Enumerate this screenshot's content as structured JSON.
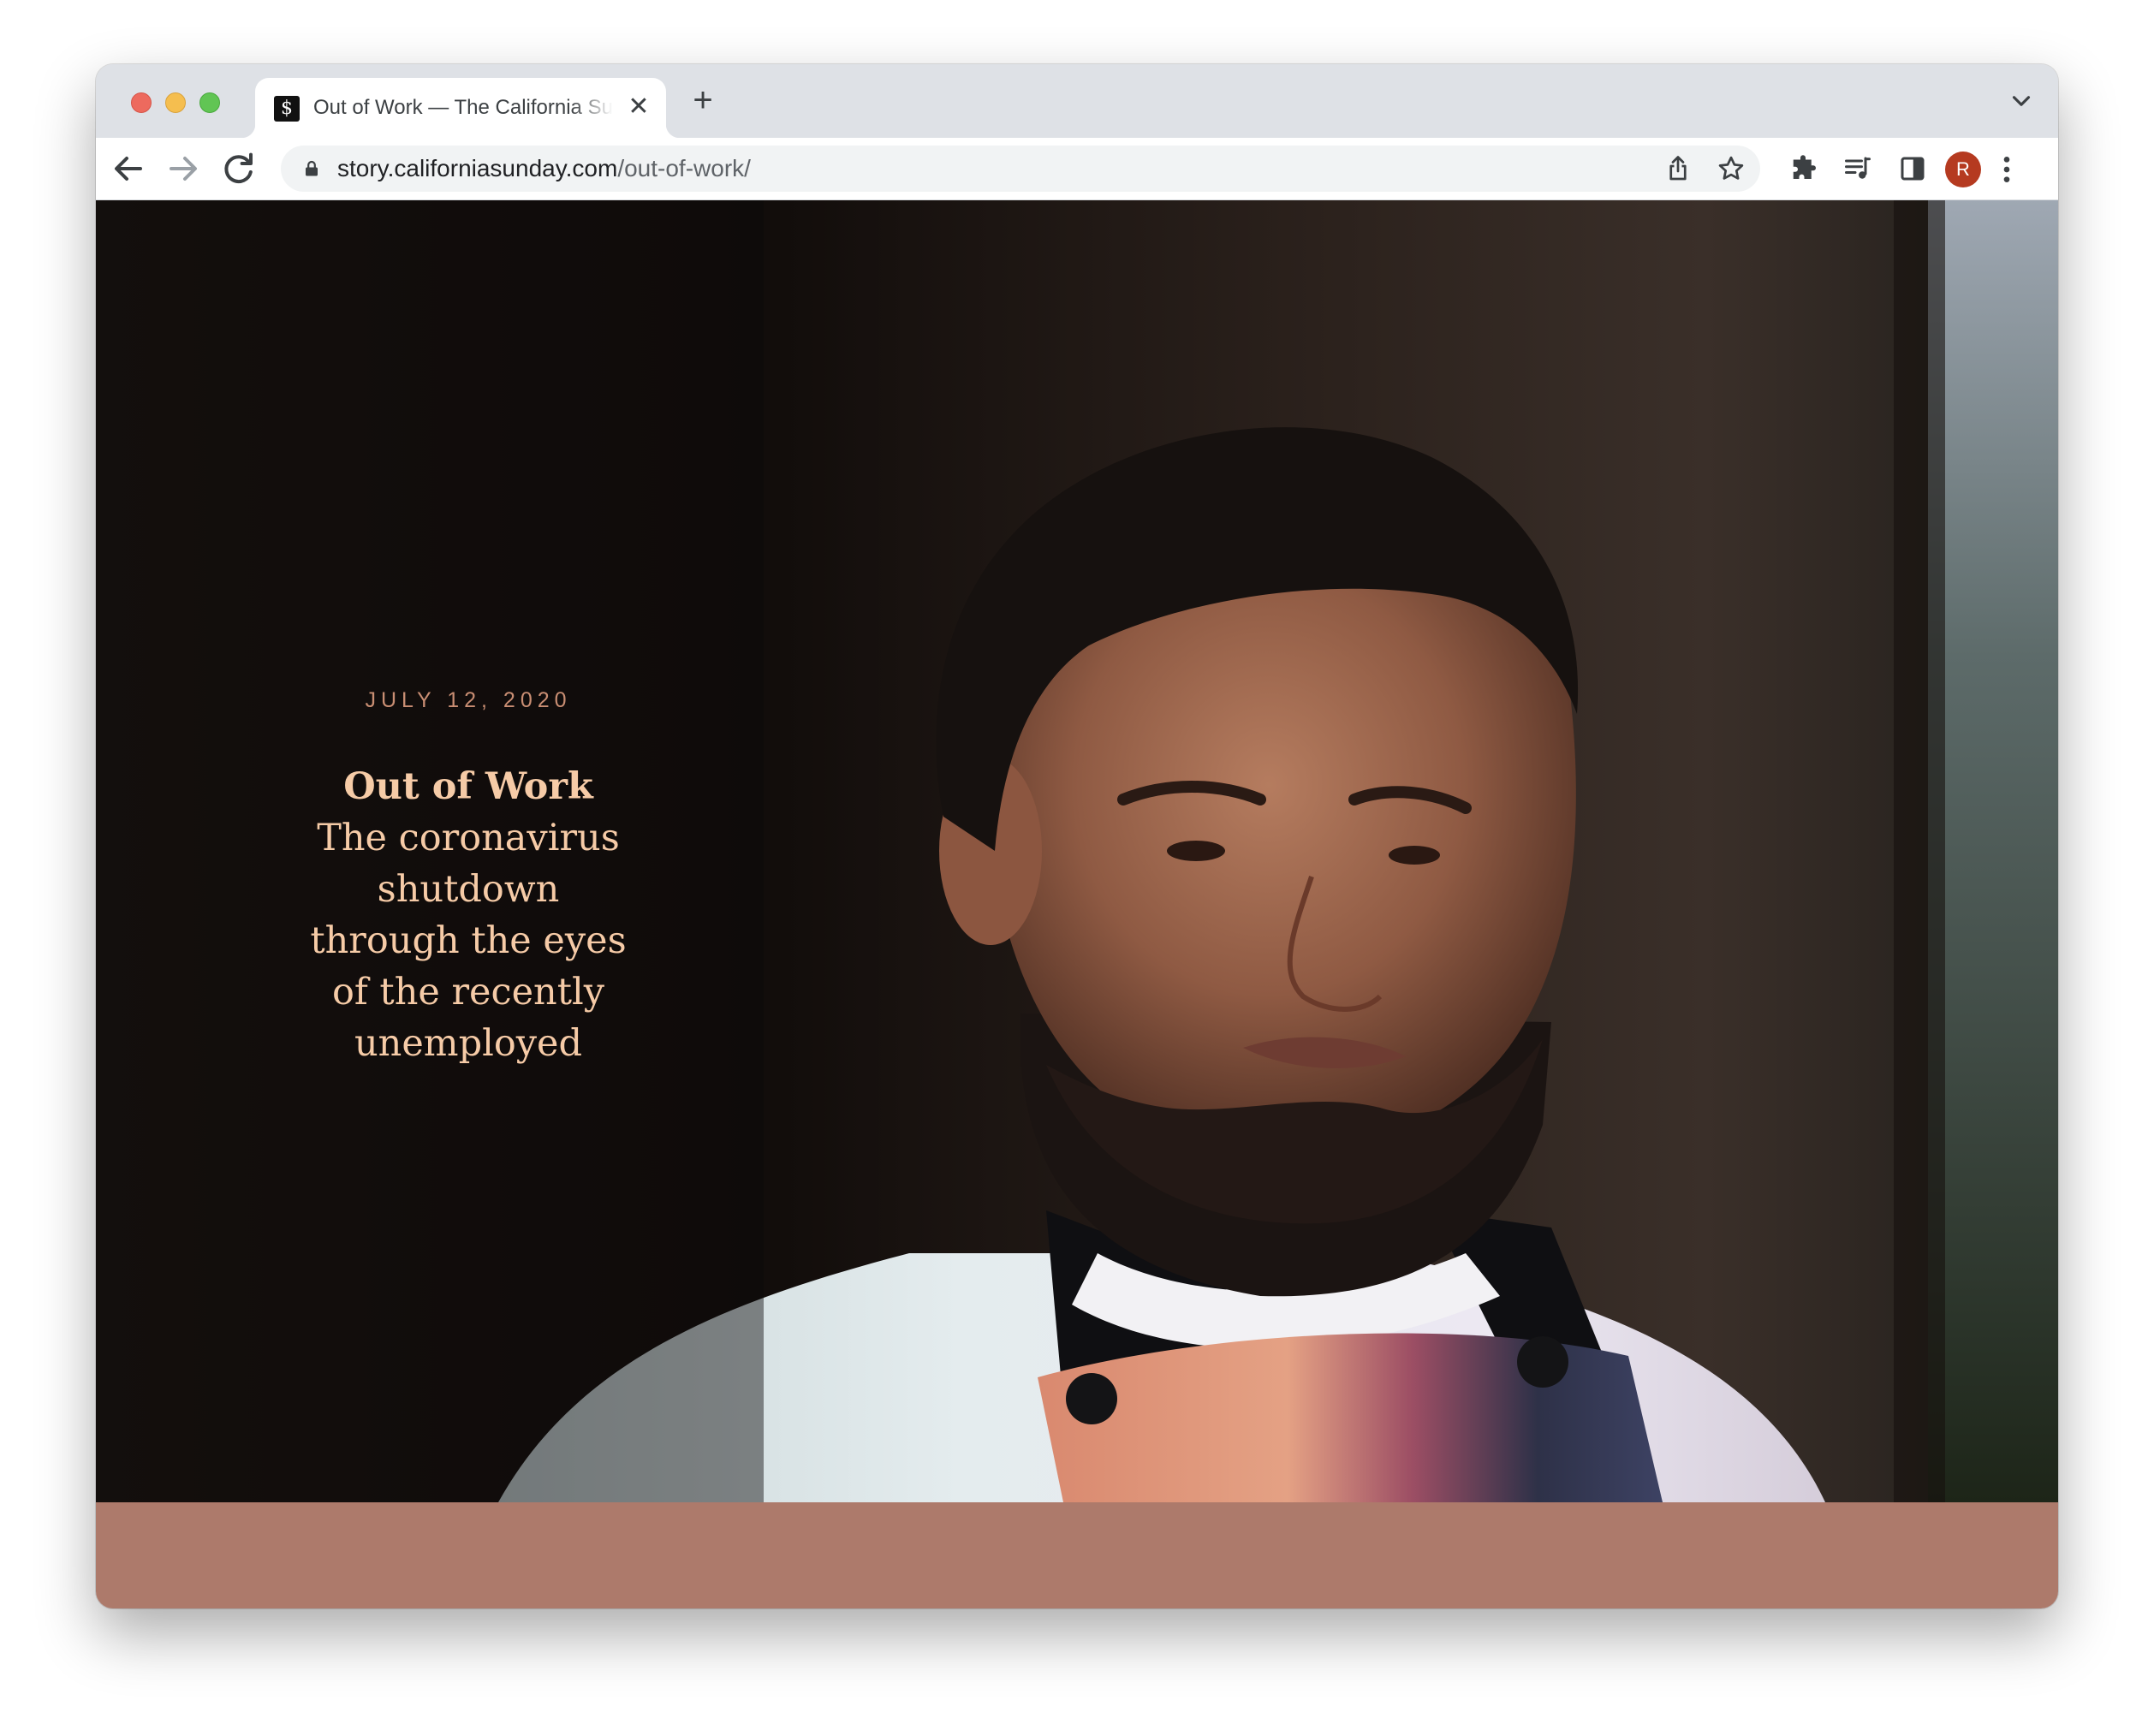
{
  "browser": {
    "tab": {
      "title": "Out of Work — The California Sunday Magazine",
      "favicon_glyph": "$",
      "close_glyph": "✕"
    },
    "new_tab_glyph": "+",
    "url": {
      "host": "story.californiasunday.com",
      "path": "/out-of-work/"
    },
    "profile_initial": "R",
    "profile_color": "#b53a20"
  },
  "article": {
    "date": "JULY 12, 2020",
    "title": "Out of Work",
    "dek": "The coronavirus shutdown through the eyes of the recently unemployed"
  },
  "colors": {
    "accent_text": "#f6cba7",
    "date_text": "#c98e73",
    "footer_band": "#ad7a6b"
  },
  "icons": {
    "back": "arrow-left-icon",
    "forward": "arrow-right-icon",
    "reload": "reload-icon",
    "lock": "lock-icon",
    "share": "share-icon",
    "bookmark": "star-icon",
    "extensions": "puzzle-icon",
    "media": "media-queue-icon",
    "side_panel": "side-panel-icon",
    "menu": "kebab-menu-icon",
    "tab_search": "chevron-down-icon"
  }
}
